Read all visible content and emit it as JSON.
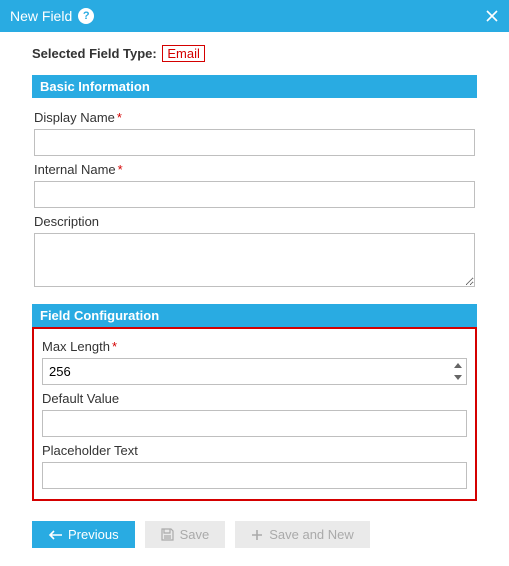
{
  "titlebar": {
    "title": "New Field"
  },
  "selected": {
    "label": "Selected Field Type:",
    "value": "Email"
  },
  "sections": {
    "basic": {
      "header": "Basic Information"
    },
    "config": {
      "header": "Field Configuration"
    }
  },
  "fields": {
    "displayName": {
      "label": "Display Name",
      "value": ""
    },
    "internalName": {
      "label": "Internal Name",
      "value": ""
    },
    "description": {
      "label": "Description",
      "value": ""
    },
    "maxLength": {
      "label": "Max Length",
      "value": "256"
    },
    "defaultValue": {
      "label": "Default Value",
      "value": ""
    },
    "placeholderText": {
      "label": "Placeholder Text",
      "value": ""
    }
  },
  "buttons": {
    "previous": "Previous",
    "save": "Save",
    "saveAndNew": "Save and New"
  }
}
